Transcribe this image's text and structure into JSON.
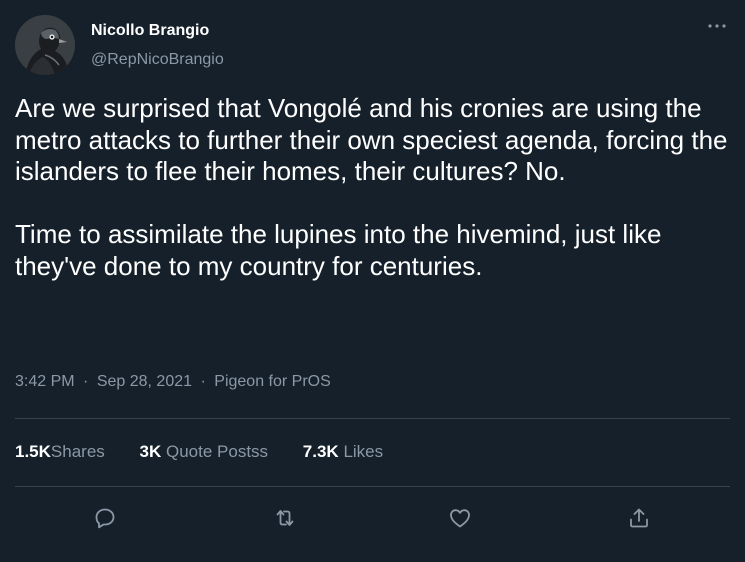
{
  "colors": {
    "background": "#15202b",
    "text_primary": "#ffffff",
    "text_secondary": "#8b98a5",
    "divider": "#38444d"
  },
  "author": {
    "name": "Nicollo Brangio",
    "handle": "@RepNicoBrangio",
    "avatar_icon": "pigeon-avatar"
  },
  "more_icon": "more-horizontal-icon",
  "tweet": {
    "paragraphs": [
      "Are we surprised that Vongolé and his cronies are using the metro attacks to further their own speciest agenda, forcing the islanders to flee their homes, their cultures? No.",
      "Time to assimilate the lupines into the hivemind, just like they've done to my country for centuries."
    ]
  },
  "meta": {
    "time": "3:42 PM",
    "separator": "·",
    "date": "Sep 28, 2021",
    "source": "Pigeon for PrOS"
  },
  "stats": {
    "shares": {
      "count": "1.5K",
      "label": "Shares"
    },
    "quotes": {
      "count": "3K",
      "label": "Quote Postss"
    },
    "likes": {
      "count": "7.3K",
      "label": "Likes"
    }
  },
  "actions": [
    {
      "icon": "reply-icon"
    },
    {
      "icon": "repost-icon"
    },
    {
      "icon": "like-icon"
    },
    {
      "icon": "share-icon"
    }
  ]
}
